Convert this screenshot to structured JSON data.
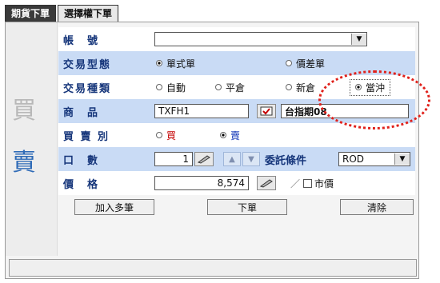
{
  "tabs": [
    "期貨下單",
    "選擇權下單"
  ],
  "side": {
    "buy": "買",
    "sell": "賣"
  },
  "labels": {
    "account": "帳　號",
    "trade_type": "交易型態",
    "trade_kind": "交易種類",
    "product": "商　品",
    "side": "買 賣 別",
    "qty": "口　數",
    "price": "價　格"
  },
  "trade_type": {
    "single": "單式單",
    "spread": "價差單"
  },
  "trade_kind": {
    "auto": "自動",
    "close": "平倉",
    "open": "新倉",
    "daytrade": "當沖"
  },
  "product": {
    "code": "TXFH1",
    "name": "台指期08"
  },
  "side_opts": {
    "buy": "買",
    "sell": "賣"
  },
  "qty": {
    "value": "1",
    "cond_label": "委託條件",
    "cond_value": "ROD"
  },
  "price": {
    "value": "8,574",
    "slash": "／",
    "market": "市價"
  },
  "buttons": {
    "add_multi": "加入多筆",
    "submit": "下單",
    "clear": "清除"
  },
  "colors": {
    "label": "#15357a",
    "row_alt": "#c9dbf5",
    "highlight": "#e0201a"
  }
}
